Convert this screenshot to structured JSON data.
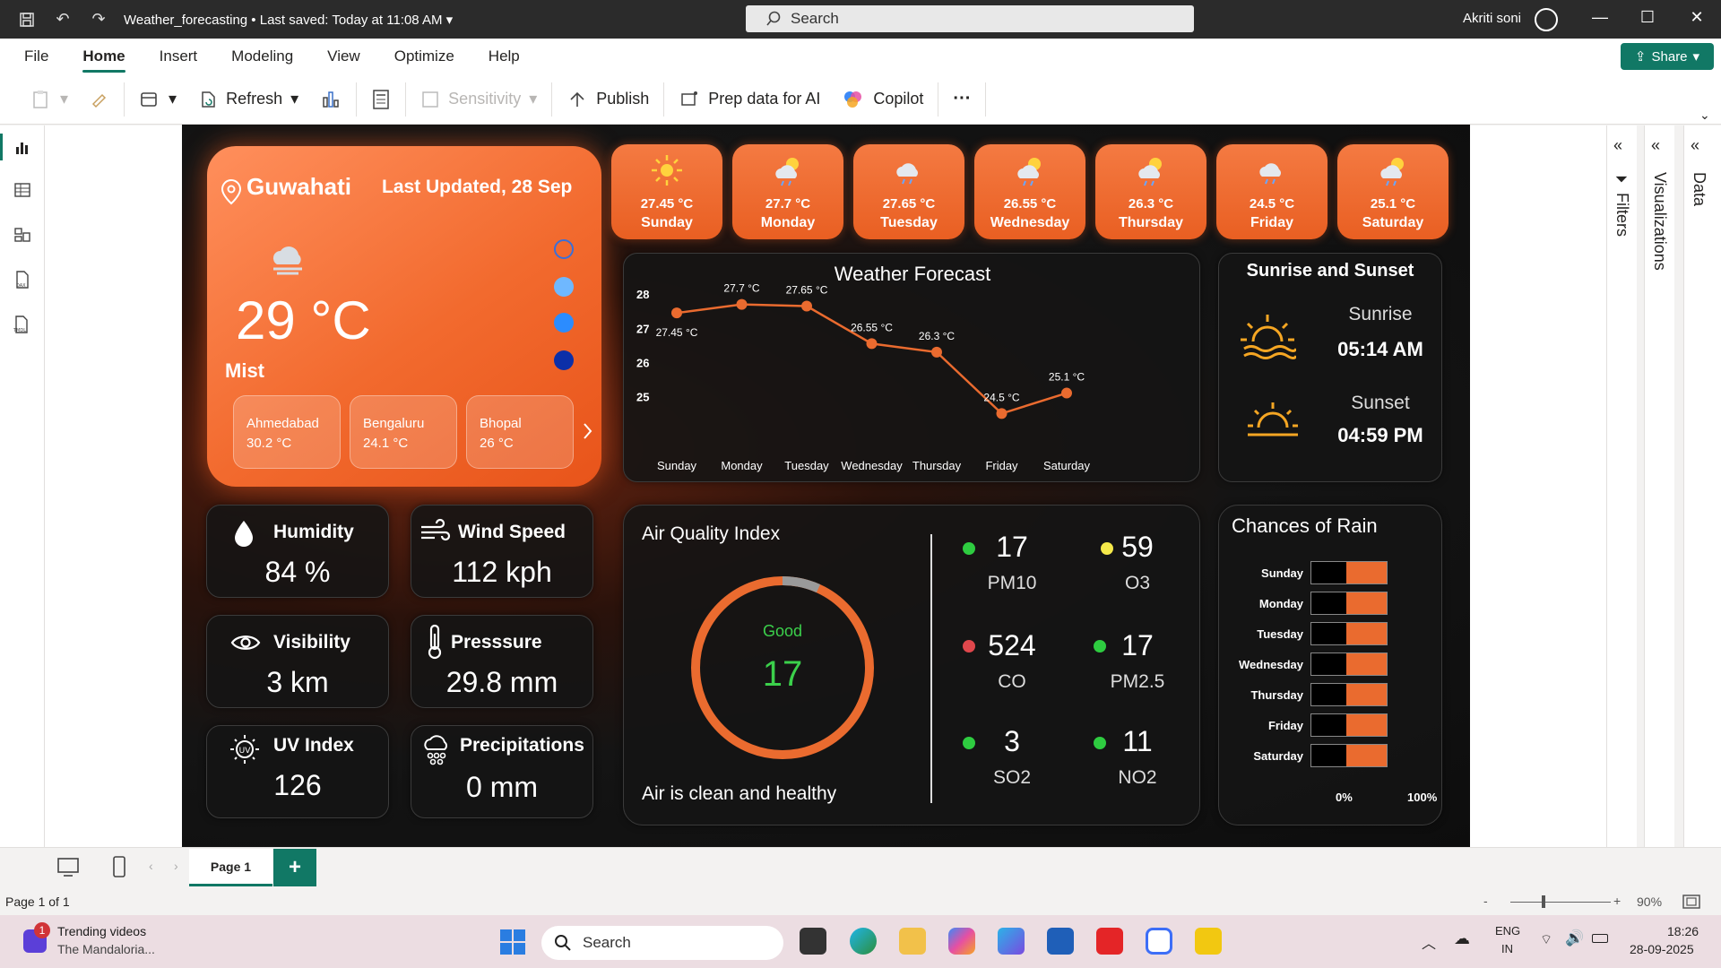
{
  "window": {
    "title": "Weather_forecasting",
    "saved": "Last saved: Today at 11:08 AM",
    "search_placeholder": "Search",
    "user": "Akriti soni"
  },
  "menu": [
    "File",
    "Home",
    "Insert",
    "Modeling",
    "View",
    "Optimize",
    "Help"
  ],
  "share_label": "Share",
  "ribbon": {
    "refresh": "Refresh",
    "sensitivity": "Sensitivity",
    "publish": "Publish",
    "prep": "Prep data for AI",
    "copilot": "Copilot",
    "more": "···"
  },
  "panes": {
    "filters": "Filters",
    "visualizations": "Visualizations",
    "data": "Data"
  },
  "page": {
    "tab": "Page 1",
    "add": "+",
    "count": "Page 1 of 1",
    "zoom": "90%"
  },
  "taskbar": {
    "trend_title": "Trending videos",
    "trend_sub": "The Mandaloria...",
    "search": "Search",
    "lang1": "ENG",
    "lang2": "IN",
    "time": "18:26",
    "date": "28-09-2025",
    "badge": "1"
  },
  "report": {
    "main": {
      "city": "Guwahati",
      "updated": "Last Updated, 28 Sep",
      "temp": "29 °C",
      "condition": "Mist",
      "cities": [
        {
          "name": "Ahmedabad",
          "temp": "30.2 °C"
        },
        {
          "name": "Bengaluru",
          "temp": "24.1 °C"
        },
        {
          "name": "Bhopal",
          "temp": "26 °C"
        }
      ]
    },
    "forecast_cards": [
      {
        "temp": "27.45 °C",
        "day": "Sunday",
        "icon": "sun-icon"
      },
      {
        "temp": "27.7 °C",
        "day": "Monday",
        "icon": "sun-cloud-rain-icon"
      },
      {
        "temp": "27.65 °C",
        "day": "Tuesday",
        "icon": "cloud-rain-icon"
      },
      {
        "temp": "26.55 °C",
        "day": "Wednesday",
        "icon": "sun-cloud-rain-icon"
      },
      {
        "temp": "26.3 °C",
        "day": "Thursday",
        "icon": "sun-cloud-rain-icon"
      },
      {
        "temp": "24.5 °C",
        "day": "Friday",
        "icon": "cloud-rain-icon"
      },
      {
        "temp": "25.1 °C",
        "day": "Saturday",
        "icon": "sun-cloud-rain-icon"
      }
    ],
    "metrics": {
      "humidity": {
        "label": "Humidity",
        "value": "84 %"
      },
      "wind": {
        "label": "Wind Speed",
        "value": "112 kph"
      },
      "visibility": {
        "label": "Visibility",
        "value": "3 km"
      },
      "pressure": {
        "label": "Presssure",
        "value": "29.8 mm"
      },
      "uv": {
        "label": "UV Index",
        "value": "126"
      },
      "precip": {
        "label": "Precipitations",
        "value": "0 mm"
      }
    },
    "aqi": {
      "title": "Air Quality Index",
      "status": "Good",
      "value": "17",
      "message": "Air is clean and healthy",
      "items": [
        {
          "value": "17",
          "label": "PM10",
          "color": "#2ecc40"
        },
        {
          "value": "59",
          "label": "O3",
          "color": "#f5e94a"
        },
        {
          "value": "524",
          "label": "CO",
          "color": "#e0474c"
        },
        {
          "value": "17",
          "label": "PM2.5",
          "color": "#2ecc40"
        },
        {
          "value": "3",
          "label": "SO2",
          "color": "#2ecc40"
        },
        {
          "value": "11",
          "label": "NO2",
          "color": "#2ecc40"
        }
      ]
    },
    "sun": {
      "title": "Sunrise and Sunset",
      "sunrise_label": "Sunrise",
      "sunrise_time": "05:14 AM",
      "sunset_label": "Sunset",
      "sunset_time": "04:59 PM"
    },
    "rain": {
      "title": "Chances of Rain",
      "axis_min": "0%",
      "axis_max": "100%"
    },
    "colors": {
      "accent": "#f26a2e",
      "good": "#2ecc40",
      "panel": "#141414"
    }
  },
  "chart_data": [
    {
      "type": "line",
      "title": "Weather Forecast",
      "categories": [
        "Sunday",
        "Monday",
        "Tuesday",
        "Wednesday",
        "Thursday",
        "Friday",
        "Saturday"
      ],
      "values": [
        27.45,
        27.7,
        27.65,
        26.55,
        26.3,
        24.5,
        25.1
      ],
      "data_labels": [
        "27.45 °C",
        "27.7 °C",
        "27.65 °C",
        "26.55 °C",
        "26.3 °C",
        "24.5 °C",
        "25.1 °C"
      ],
      "yticks": [
        25,
        26,
        27,
        28
      ],
      "ylim": [
        24.3,
        28.4
      ],
      "grid": false
    },
    {
      "type": "bar",
      "title": "Chances of Rain",
      "categories": [
        "Sunday",
        "Monday",
        "Tuesday",
        "Wednesday",
        "Thursday",
        "Friday",
        "Saturday"
      ],
      "values": [
        53,
        53,
        53,
        53,
        53,
        53,
        53
      ],
      "xlim": [
        0,
        100
      ],
      "xticks": [
        "0%",
        "100%"
      ]
    }
  ]
}
